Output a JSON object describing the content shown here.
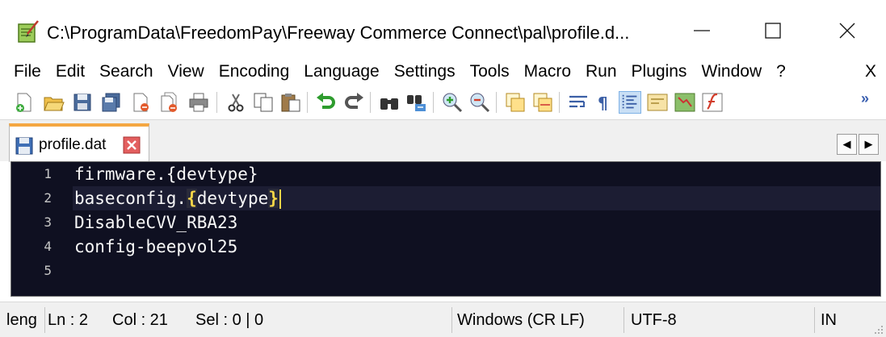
{
  "window": {
    "title": "C:\\ProgramData\\FreedomPay\\Freeway Commerce Connect\\pal\\profile.d...",
    "app_icon": "notepad-plus-plus-icon",
    "minimize_icon": "minimize-icon",
    "maximize_icon": "maximize-icon",
    "close_icon": "close-icon"
  },
  "menu": {
    "items": [
      "File",
      "Edit",
      "Search",
      "View",
      "Encoding",
      "Language",
      "Settings",
      "Tools",
      "Macro",
      "Run",
      "Plugins",
      "Window",
      "?"
    ],
    "close_doc": "X"
  },
  "toolbar": {
    "buttons": [
      "new-file-icon",
      "open-file-icon",
      "save-icon",
      "save-all-icon",
      "close-icon",
      "close-all-icon",
      "print-icon",
      "cut-icon",
      "copy-icon",
      "paste-icon",
      "undo-icon",
      "redo-icon",
      "find-icon",
      "replace-icon",
      "zoom-in-icon",
      "zoom-out-icon",
      "sync-vertical-icon",
      "sync-horizontal-icon",
      "word-wrap-icon",
      "show-all-characters-icon",
      "indent-guide-icon",
      "user-defined-language-icon",
      "document-map-icon",
      "function-list-icon"
    ],
    "overflow": "»"
  },
  "tabs": [
    {
      "label": "profile.dat",
      "icon": "floppy-disk-icon",
      "close_icon": "tab-close-icon",
      "active": true
    }
  ],
  "tab_nav": {
    "left": "◀",
    "right": "▶"
  },
  "editor": {
    "line_numbers": [
      "1",
      "2",
      "3",
      "4",
      "5"
    ],
    "current_line": 2,
    "lines": {
      "l1": "firmware.{devtype}",
      "l2_prefix": "baseconfig.",
      "l2_open": "{",
      "l2_mid": "devtype",
      "l2_close": "}",
      "l3": "DisableCVV_RBA23",
      "l4": "config-beepvol25",
      "l5": ""
    },
    "colors": {
      "background": "#0f1021",
      "text": "#f8f8f8",
      "brace_highlight": "#f8d748",
      "current_line": "#1c1d33"
    }
  },
  "status": {
    "length": "leng",
    "ln": "Ln : 2",
    "col": "Col : 21",
    "sel": "Sel : 0 | 0",
    "eol": "Windows (CR LF)",
    "encoding": "UTF-8",
    "mode": "IN"
  }
}
